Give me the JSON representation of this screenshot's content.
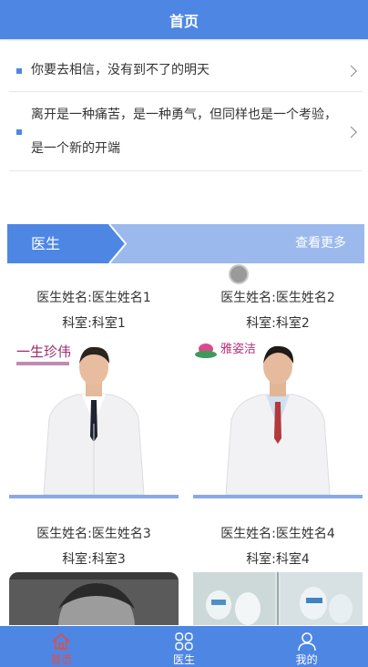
{
  "header": {
    "title": "首页"
  },
  "notices": [
    {
      "text": "你要去相信，没有到不了的明天"
    },
    {
      "text": "离开是一种痛苦，是一种勇气，但同样也是一个考验，是一个新的开端"
    }
  ],
  "section": {
    "title": "医生",
    "more": "查看更多"
  },
  "doctors": [
    {
      "name": "医生姓名:医生姓名1",
      "dept": "科室:科室1",
      "logo": "一生珍伟"
    },
    {
      "name": "医生姓名:医生姓名2",
      "dept": "科室:科室2",
      "logo": "雅姿洁"
    },
    {
      "name": "医生姓名:医生姓名3",
      "dept": "科室:科室3"
    },
    {
      "name": "医生姓名:医生姓名4",
      "dept": "科室:科室4"
    }
  ],
  "nav": [
    {
      "label": "首页",
      "icon": "home-icon",
      "active": true
    },
    {
      "label": "医生",
      "icon": "grid-icon",
      "active": false
    },
    {
      "label": "我的",
      "icon": "user-icon",
      "active": false
    }
  ],
  "colors": {
    "primary": "#4e86e4",
    "section_bg": "#9bb9ec",
    "active_nav": "#e74c3c"
  }
}
